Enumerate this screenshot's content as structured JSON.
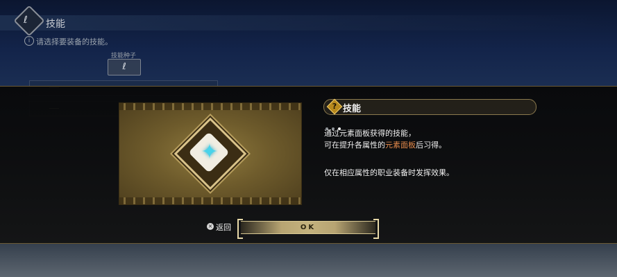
{
  "header": {
    "title": "技能",
    "hint": "请选择要装备的技能。",
    "emblem_glyph": "ℓ"
  },
  "seed": {
    "label": "技能种子",
    "glyph": "ℓ"
  },
  "dialog": {
    "info_title": "技能",
    "info_icon": "?",
    "page_dots": 3,
    "active_dot": 3,
    "line1": "通过元素面板获得的技能，",
    "line2_prefix": "可在提升各属性的",
    "line2_highlight": "元素面板",
    "line2_suffix": "后习得。",
    "line3": "仅在相应属性的职业装备时发挥效果。",
    "highlight_color": "#e58a4b",
    "skill_icon": "four-point-star-icon",
    "skill_star_glyph": "✦"
  },
  "controls": {
    "back_key": "×",
    "back_label": "返回",
    "ok_label": "OK"
  }
}
